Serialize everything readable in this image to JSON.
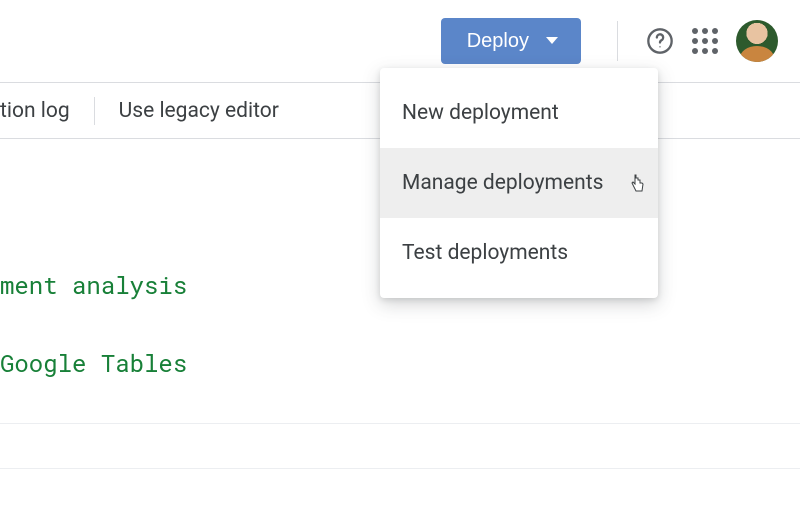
{
  "topbar": {
    "deploy_label": "Deploy"
  },
  "subbar": {
    "execution_log": "tion log",
    "legacy_editor": "Use legacy editor"
  },
  "dropdown": {
    "items": [
      {
        "label": "New deployment"
      },
      {
        "label": "Manage deployments"
      },
      {
        "label": "Test deployments"
      }
    ]
  },
  "code": {
    "line1": "ment analysis",
    "line2": "Google Tables"
  }
}
